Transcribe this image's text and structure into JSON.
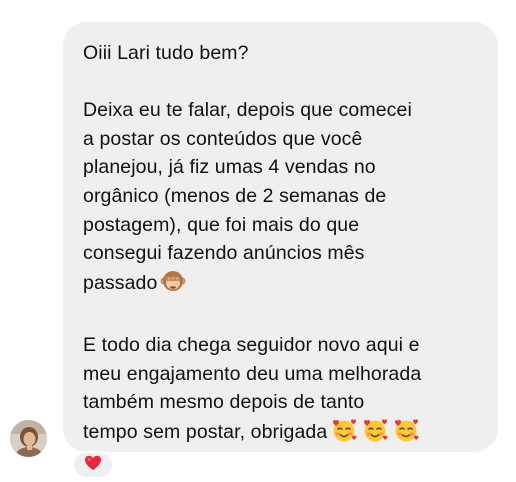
{
  "message": {
    "greeting": "Oiii Lari tudo bem?",
    "paragraph_1_lines": [
      "Deixa eu te falar, depois que comecei",
      "a postar os conteúdos que você",
      "planejou, já fiz umas 4 vendas no",
      "orgânico (menos de 2 semanas de",
      "postagem), que foi mais do que",
      "consegui fazendo anúncios mês",
      "passado"
    ],
    "paragraph_2_lines": [
      "E todo dia chega seguidor novo aqui e",
      "meu engajamento deu uma melhorada",
      "também mesmo depois de tanto",
      "tempo sem postar, obrigada"
    ],
    "emoji_after_paragraph_1": "see-no-evil-monkey-icon",
    "emojis_after_paragraph_2": [
      "smiling-face-with-hearts-icon",
      "smiling-face-with-hearts-icon",
      "smiling-face-with-hearts-icon"
    ]
  },
  "reaction": {
    "icon": "red-heart-icon",
    "color": "#e8283f"
  },
  "colors": {
    "bubble_background": "#efefef",
    "text": "#111111"
  }
}
